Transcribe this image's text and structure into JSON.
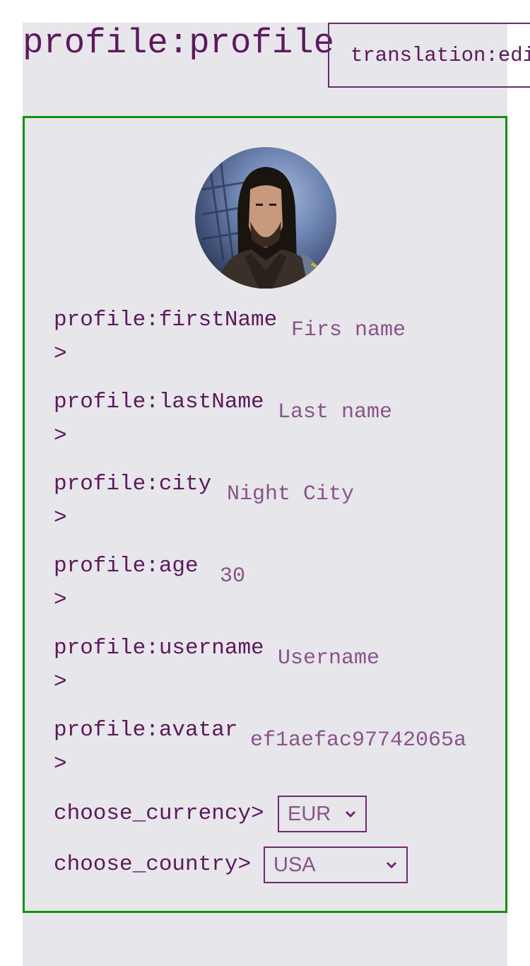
{
  "header": {
    "title": "profile:profile",
    "edit_button": "translation:edit"
  },
  "profile": {
    "avatar_alt": "avatar",
    "fields": [
      {
        "label": "profile:firstName\n>",
        "value": "Firs name"
      },
      {
        "label": "profile:lastName\n>",
        "value": "Last name"
      },
      {
        "label": "profile:city\n>",
        "value": "Night City"
      },
      {
        "label": "profile:age\n>",
        "value": "30"
      },
      {
        "label": "profile:username\n>",
        "value": "Username"
      },
      {
        "label": "profile:avatar\n>",
        "value": "ef1aefac97742065a"
      }
    ],
    "currency": {
      "label": "choose_currency>",
      "selected": "EUR"
    },
    "country": {
      "label": "choose_country>",
      "selected": "USA"
    }
  },
  "icons": {
    "chevron": "chevron-down-icon"
  },
  "colors": {
    "text": "#5c1a5c",
    "input_text": "#8a538a",
    "card_border": "#119311",
    "page_bg": "#e7e6ea"
  }
}
